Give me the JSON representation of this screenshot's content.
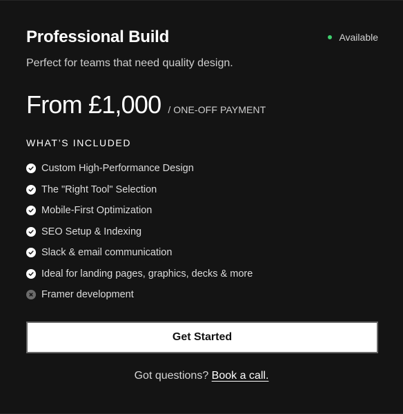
{
  "plan": {
    "title": "Professional Build",
    "status": {
      "label": "Available",
      "color": "#3fcf6e"
    },
    "subtitle": "Perfect for teams that need quality design.",
    "price": "From £1,000",
    "price_note": "/ ONE-OFF PAYMENT"
  },
  "features_section": {
    "heading": "WHAT’S INCLUDED",
    "items": [
      {
        "label": "Custom High-Performance Design",
        "icon": "check-circle-icon",
        "included": true
      },
      {
        "label": "The \"Right Tool\" Selection",
        "icon": "check-circle-icon",
        "included": true
      },
      {
        "label": "Mobile-First Optimization",
        "icon": "check-circle-icon",
        "included": true
      },
      {
        "label": "SEO Setup & Indexing",
        "icon": "check-circle-icon",
        "included": true
      },
      {
        "label": "Slack & email communication",
        "icon": "check-circle-icon",
        "included": true
      },
      {
        "label": "Ideal for landing pages, graphics, decks & more",
        "icon": "check-circle-icon",
        "included": true
      },
      {
        "label": "Framer development",
        "icon": "x-circle-icon",
        "included": false
      }
    ]
  },
  "cta": {
    "label": "Get Started"
  },
  "help": {
    "question": "Got questions?",
    "link_label": "Book a call."
  }
}
